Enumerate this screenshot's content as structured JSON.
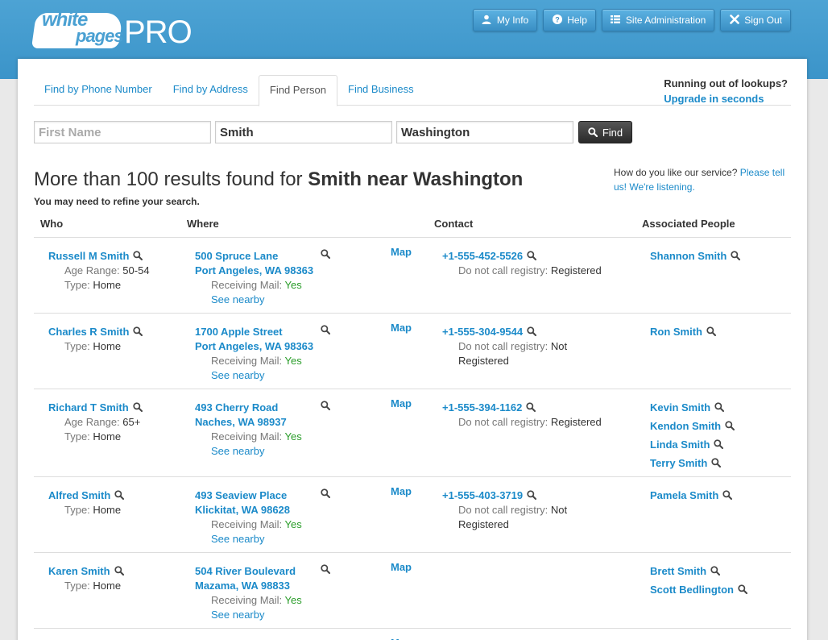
{
  "header": {
    "logo_word1": "white",
    "logo_word2": "pages",
    "logo_pro": "PRO",
    "nav": [
      {
        "label": "My Info",
        "icon": "user-icon"
      },
      {
        "label": "Help",
        "icon": "help-icon"
      },
      {
        "label": "Site Administration",
        "icon": "list-icon"
      },
      {
        "label": "Sign Out",
        "icon": "close-icon"
      }
    ]
  },
  "tabs": [
    {
      "label": "Find by Phone Number"
    },
    {
      "label": "Find by Address"
    },
    {
      "label": "Find Person"
    },
    {
      "label": "Find Business"
    }
  ],
  "upsell": {
    "question": "Running out of lookups?",
    "link": "Upgrade in seconds"
  },
  "search": {
    "first_name_placeholder": "First Name",
    "first_name_value": "",
    "last_name_value": "Smith",
    "location_value": "Washington",
    "find_label": "Find"
  },
  "results": {
    "prefix": "More than 100 results found for ",
    "query": "Smith near Washington",
    "refine": "You may need to refine your search."
  },
  "feedback": {
    "text": "How do you like our service?",
    "link": "Please tell us! We're listening."
  },
  "columns": {
    "who": "Who",
    "where": "Where",
    "contact": "Contact",
    "associated": "Associated People"
  },
  "labels": {
    "age_range": "Age Range:",
    "type": "Type:",
    "receiving_mail": "Receiving Mail:",
    "see_nearby": "See nearby",
    "map": "Map",
    "dnc": "Do not call registry:"
  },
  "rows": [
    {
      "name": "Russell M Smith",
      "age": "50-54",
      "type": "Home",
      "street": "500 Spruce Lane",
      "city": "Port Angeles, WA 98363",
      "mail": "Yes",
      "phone": "+1-555-452-5526",
      "dnc_status": "Registered",
      "associated": [
        "Shannon Smith"
      ]
    },
    {
      "name": "Charles R Smith",
      "age": "",
      "type": "Home",
      "street": "1700 Apple Street",
      "city": "Port Angeles, WA 98363",
      "mail": "Yes",
      "phone": "+1-555-304-9544",
      "dnc_status": "Not Registered",
      "associated": [
        "Ron Smith"
      ]
    },
    {
      "name": "Richard T Smith",
      "age": "65+",
      "type": "Home",
      "street": "493 Cherry Road",
      "city": "Naches, WA 98937",
      "mail": "Yes",
      "phone": "+1-555-394-1162",
      "dnc_status": "Registered",
      "associated": [
        "Kevin Smith",
        "Kendon Smith",
        "Linda Smith",
        "Terry Smith"
      ]
    },
    {
      "name": "Alfred Smith",
      "age": "",
      "type": "Home",
      "street": "493 Seaview Place",
      "city": "Klickitat, WA 98628",
      "mail": "Yes",
      "phone": "+1-555-403-3719",
      "dnc_status": "Not Registered",
      "associated": [
        "Pamela Smith"
      ]
    },
    {
      "name": "Karen Smith",
      "age": "",
      "type": "Home",
      "street": "504 River Boulevard",
      "city": "Mazama, WA 98833",
      "mail": "Yes",
      "phone": "",
      "dnc_status": "",
      "associated": [
        "Brett Smith",
        "Scott Bedlington"
      ]
    }
  ],
  "colors": {
    "link": "#1b8ac9",
    "header": "#3b94c9",
    "yes": "#2a9d2a"
  }
}
